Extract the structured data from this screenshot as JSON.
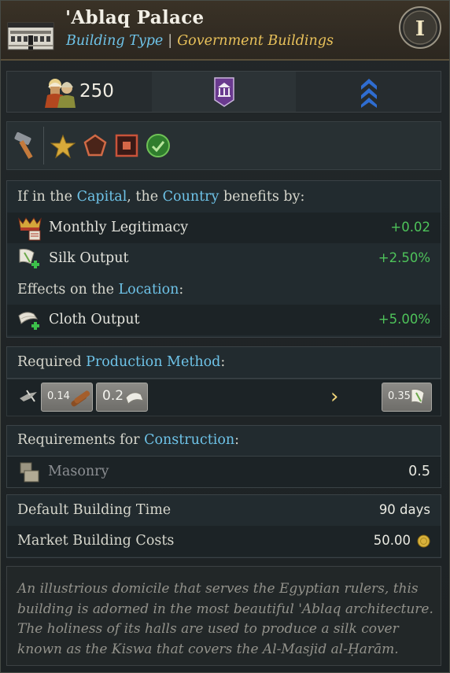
{
  "header": {
    "title": "'Ablaq Palace",
    "type_label": "Building Type",
    "separator": "|",
    "category": "Government Buildings",
    "tier_numeral": "I"
  },
  "stats": {
    "cost": "250"
  },
  "capital_section": {
    "prefix": "If in the ",
    "capital": "Capital",
    "mid": ", the ",
    "country": "Country",
    "suffix": " benefits by:"
  },
  "effects_country": [
    {
      "label": "Monthly Legitimacy",
      "value": "+0.02",
      "icon": "legitimacy-icon"
    },
    {
      "label": "Silk Output",
      "value": "+2.50%",
      "icon": "silk-icon"
    }
  ],
  "location_section": {
    "prefix": "Effects on the ",
    "location": "Location",
    "suffix": ":"
  },
  "effects_location": [
    {
      "label": "Cloth Output",
      "value": "+5.00%",
      "icon": "cloth-icon"
    }
  ],
  "production": {
    "prefix": "Required ",
    "link": "Production Method",
    "suffix": ":",
    "inputs": [
      "0.14",
      "0.2"
    ],
    "arrow": "›",
    "output": "0.35"
  },
  "construction": {
    "prefix": "Requirements for ",
    "link": "Construction",
    "suffix": ":",
    "item_label": "Masonry",
    "item_value": "0.5"
  },
  "timing": {
    "time_label": "Default Building Time",
    "time_value": "90 days",
    "cost_label": "Market Building Costs",
    "cost_value": "50.00"
  },
  "description": "An illustrious domicile that serves the Egyptian rulers, this building is adorned in the most beautiful 'Ablaq architecture. The holiness of its halls are used to produce a silk cover known as the Kiswa that covers the Al-Masjid al-Ḥarām.",
  "colors": {
    "accent_blue": "#6ec3e8",
    "gold": "#e8c15a",
    "positive": "#4ec35a"
  }
}
